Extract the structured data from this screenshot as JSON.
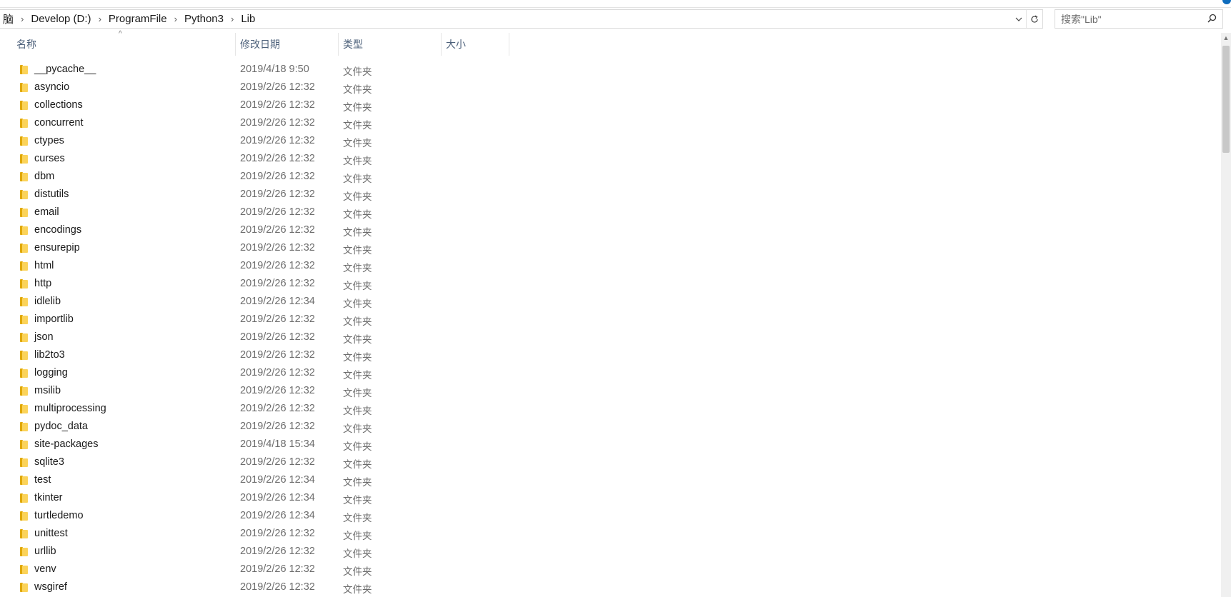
{
  "address": {
    "crumbs": [
      "脑",
      "Develop (D:)",
      "ProgramFile",
      "Python3",
      "Lib"
    ],
    "separator": "›",
    "dropdown_icon": "chevron-down-icon",
    "refresh_icon": "refresh-icon"
  },
  "search": {
    "placeholder": "搜索\"Lib\"",
    "icon": "search-icon"
  },
  "columns": {
    "name": "名称",
    "date": "修改日期",
    "type": "类型",
    "size": "大小"
  },
  "files": [
    {
      "name": "__pycache__",
      "date": "2019/4/18 9:50",
      "type": "文件夹"
    },
    {
      "name": "asyncio",
      "date": "2019/2/26 12:32",
      "type": "文件夹"
    },
    {
      "name": "collections",
      "date": "2019/2/26 12:32",
      "type": "文件夹"
    },
    {
      "name": "concurrent",
      "date": "2019/2/26 12:32",
      "type": "文件夹"
    },
    {
      "name": "ctypes",
      "date": "2019/2/26 12:32",
      "type": "文件夹"
    },
    {
      "name": "curses",
      "date": "2019/2/26 12:32",
      "type": "文件夹"
    },
    {
      "name": "dbm",
      "date": "2019/2/26 12:32",
      "type": "文件夹"
    },
    {
      "name": "distutils",
      "date": "2019/2/26 12:32",
      "type": "文件夹"
    },
    {
      "name": "email",
      "date": "2019/2/26 12:32",
      "type": "文件夹"
    },
    {
      "name": "encodings",
      "date": "2019/2/26 12:32",
      "type": "文件夹"
    },
    {
      "name": "ensurepip",
      "date": "2019/2/26 12:32",
      "type": "文件夹"
    },
    {
      "name": "html",
      "date": "2019/2/26 12:32",
      "type": "文件夹"
    },
    {
      "name": "http",
      "date": "2019/2/26 12:32",
      "type": "文件夹"
    },
    {
      "name": "idlelib",
      "date": "2019/2/26 12:34",
      "type": "文件夹"
    },
    {
      "name": "importlib",
      "date": "2019/2/26 12:32",
      "type": "文件夹"
    },
    {
      "name": "json",
      "date": "2019/2/26 12:32",
      "type": "文件夹"
    },
    {
      "name": "lib2to3",
      "date": "2019/2/26 12:32",
      "type": "文件夹"
    },
    {
      "name": "logging",
      "date": "2019/2/26 12:32",
      "type": "文件夹"
    },
    {
      "name": "msilib",
      "date": "2019/2/26 12:32",
      "type": "文件夹"
    },
    {
      "name": "multiprocessing",
      "date": "2019/2/26 12:32",
      "type": "文件夹"
    },
    {
      "name": "pydoc_data",
      "date": "2019/2/26 12:32",
      "type": "文件夹"
    },
    {
      "name": "site-packages",
      "date": "2019/4/18 15:34",
      "type": "文件夹"
    },
    {
      "name": "sqlite3",
      "date": "2019/2/26 12:32",
      "type": "文件夹"
    },
    {
      "name": "test",
      "date": "2019/2/26 12:34",
      "type": "文件夹"
    },
    {
      "name": "tkinter",
      "date": "2019/2/26 12:34",
      "type": "文件夹"
    },
    {
      "name": "turtledemo",
      "date": "2019/2/26 12:34",
      "type": "文件夹"
    },
    {
      "name": "unittest",
      "date": "2019/2/26 12:32",
      "type": "文件夹"
    },
    {
      "name": "urllib",
      "date": "2019/2/26 12:32",
      "type": "文件夹"
    },
    {
      "name": "venv",
      "date": "2019/2/26 12:32",
      "type": "文件夹"
    },
    {
      "name": "wsgiref",
      "date": "2019/2/26 12:32",
      "type": "文件夹"
    }
  ]
}
